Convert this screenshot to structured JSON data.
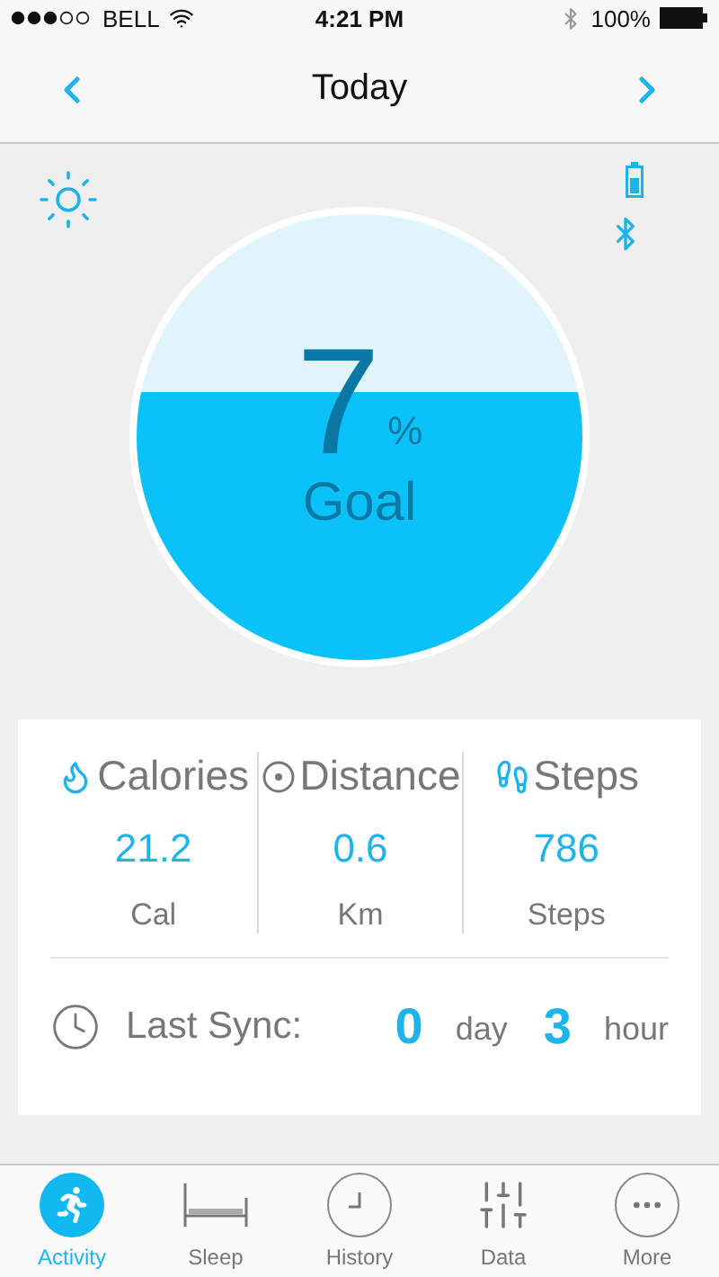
{
  "status_bar": {
    "carrier": "BELL",
    "time": "4:21 PM",
    "battery": "100%"
  },
  "nav": {
    "title": "Today"
  },
  "goal": {
    "value": "7",
    "unit": "%",
    "label": "Goal"
  },
  "stats": [
    {
      "kind": "calories",
      "title": "Calories",
      "value": "21.2",
      "unit": "Cal"
    },
    {
      "kind": "distance",
      "title": "Distance",
      "value": "0.6",
      "unit": "Km"
    },
    {
      "kind": "steps",
      "title": "Steps",
      "value": "786",
      "unit": "Steps"
    }
  ],
  "sync": {
    "label": "Last Sync:",
    "days": "0",
    "day_unit": "day",
    "hours": "3",
    "hour_unit": "hour"
  },
  "tabs": [
    {
      "kind": "activity",
      "label": "Activity",
      "selected": true
    },
    {
      "kind": "sleep",
      "label": "Sleep",
      "selected": false
    },
    {
      "kind": "history",
      "label": "History",
      "selected": false
    },
    {
      "kind": "data",
      "label": "Data",
      "selected": false
    },
    {
      "kind": "more",
      "label": "More",
      "selected": false
    }
  ]
}
